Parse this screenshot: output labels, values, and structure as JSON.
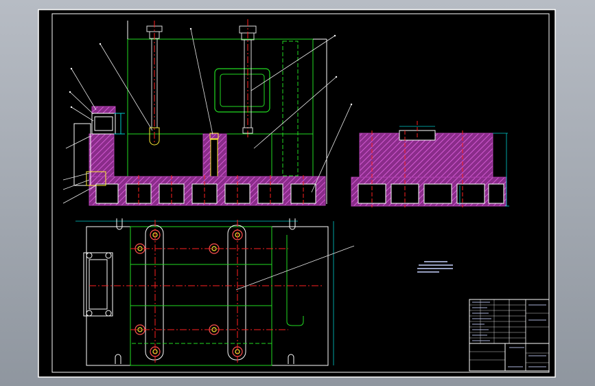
{
  "viewer": {
    "background": "#000000",
    "frame_color": "#ffffff"
  },
  "colors": {
    "outline_green": "#22dd22",
    "hatch_magenta": "#b040b0",
    "dim_cyan": "#00cccc",
    "center_red": "#ff2020",
    "leader_white": "#e8e8e8",
    "text_blue": "#c8d2ff"
  },
  "notes": {
    "text": ""
  },
  "title_block": {
    "drawing_title": "",
    "drawing_no": ""
  }
}
